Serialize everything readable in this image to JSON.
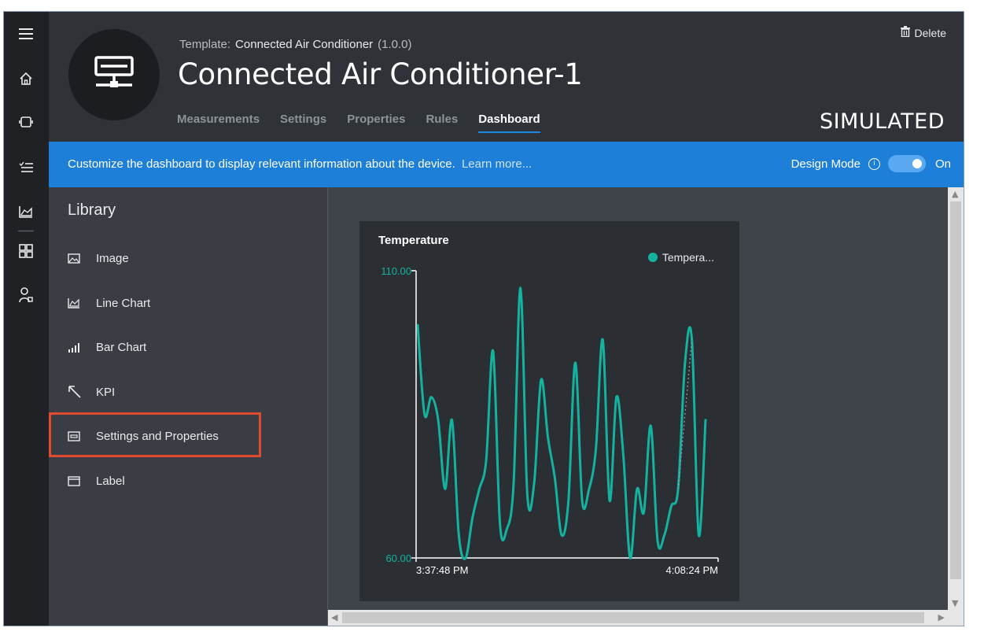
{
  "header": {
    "template_label": "Template:",
    "template_name": "Connected Air Conditioner",
    "template_version": "(1.0.0)",
    "device_title": "Connected Air Conditioner-1",
    "delete_label": "Delete",
    "simulated_label": "SIMULATED",
    "tabs": [
      {
        "label": "Measurements",
        "active": false
      },
      {
        "label": "Settings",
        "active": false
      },
      {
        "label": "Properties",
        "active": false
      },
      {
        "label": "Rules",
        "active": false
      },
      {
        "label": "Dashboard",
        "active": true
      }
    ]
  },
  "rail": {
    "icons": [
      "hamburger-menu-icon",
      "home-icon",
      "devices-icon",
      "explorer-list-icon",
      "analytics-icon",
      "app-grid-icon",
      "users-icon"
    ]
  },
  "banner": {
    "text": "Customize the dashboard to display relevant information about the device.",
    "link": "Learn more...",
    "design_mode_label": "Design Mode",
    "toggle_state": "On",
    "color": "#1e7fd8"
  },
  "library": {
    "title": "Library",
    "items": [
      {
        "label": "Image",
        "icon": "image-icon"
      },
      {
        "label": "Line Chart",
        "icon": "line-chart-icon"
      },
      {
        "label": "Bar Chart",
        "icon": "bar-chart-icon"
      },
      {
        "label": "KPI",
        "icon": "kpi-arrow-icon"
      },
      {
        "label": "Settings and Properties",
        "icon": "settings-properties-icon",
        "highlighted": true
      },
      {
        "label": "Label",
        "icon": "label-icon"
      }
    ]
  },
  "chart_data": {
    "type": "line",
    "title": "Temperature",
    "series": [
      {
        "name": "Tempera...",
        "color": "#13b3a0",
        "values": [
          100.5,
          85,
          88,
          84,
          72,
          84,
          64,
          60,
          67,
          72,
          77,
          96,
          66,
          65,
          73,
          107,
          71,
          73,
          91,
          81,
          74,
          64,
          70,
          94,
          70,
          72,
          79,
          98,
          70,
          88,
          78,
          60,
          72,
          68,
          83,
          63,
          64,
          69,
          72,
          94,
          98,
          64,
          84
        ]
      }
    ],
    "x_tick_labels": [
      "3:37:48 PM",
      "4:08:24 PM"
    ],
    "y_tick_labels": [
      "110.00",
      "60.00"
    ],
    "ylim": [
      60,
      110
    ],
    "axis_color": "#13b3a0",
    "legend_position": "top-right"
  }
}
